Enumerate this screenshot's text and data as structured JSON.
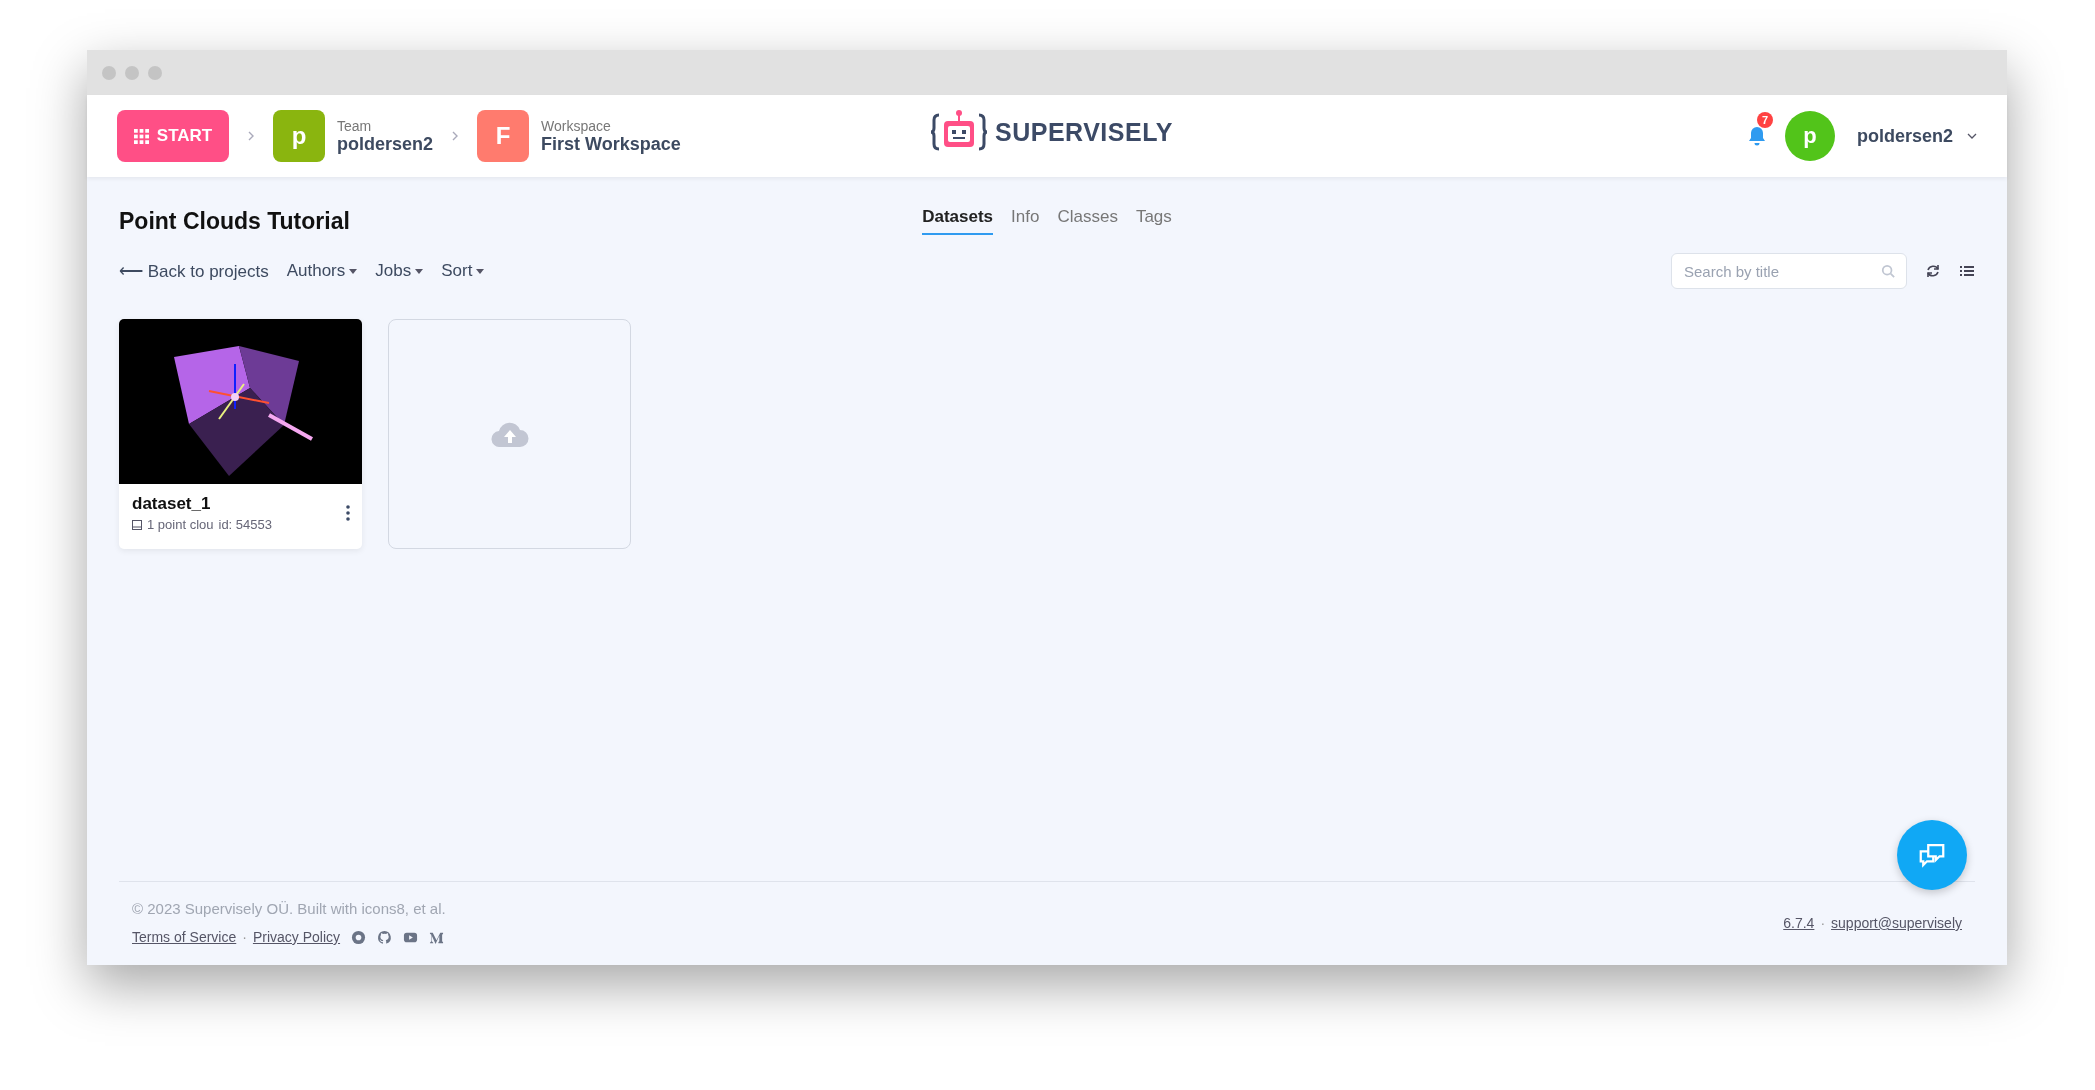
{
  "header": {
    "start_button": "START",
    "breadcrumbs": [
      {
        "avatar": "p",
        "color": "#8ab50f",
        "label": "Team",
        "value": "poldersen2"
      },
      {
        "avatar": "F",
        "color": "#ff7b6e",
        "label": "Workspace",
        "value": "First Workspace"
      }
    ],
    "logo": "SUPERVISELY",
    "notification_count": "7",
    "user": {
      "avatar": "p",
      "name": "poldersen2"
    }
  },
  "page_title": "Point Clouds Tutorial",
  "tabs": [
    {
      "label": "Datasets",
      "selected": true
    },
    {
      "label": "Info",
      "selected": false
    },
    {
      "label": "Classes",
      "selected": false
    },
    {
      "label": "Tags",
      "selected": false
    }
  ],
  "toolbar": {
    "back": "⟵ Back to projects",
    "menus": [
      "Authors",
      "Jobs",
      "Sort"
    ],
    "search": {
      "placeholder": "Search by title"
    }
  },
  "cards": [
    {
      "kind": "dataset",
      "name": "dataset_1",
      "count": "1 point clou",
      "id": "id: 54553"
    },
    {
      "kind": "upload"
    }
  ],
  "footer": {
    "copyright": "© 2023 Supervisely OÜ. Built with icons8, et al.",
    "links": [
      "Terms of Service",
      "Privacy Policy"
    ],
    "separator": "·",
    "version": "6.7.4",
    "version_separator": "·",
    "email": "support@supervisely"
  }
}
